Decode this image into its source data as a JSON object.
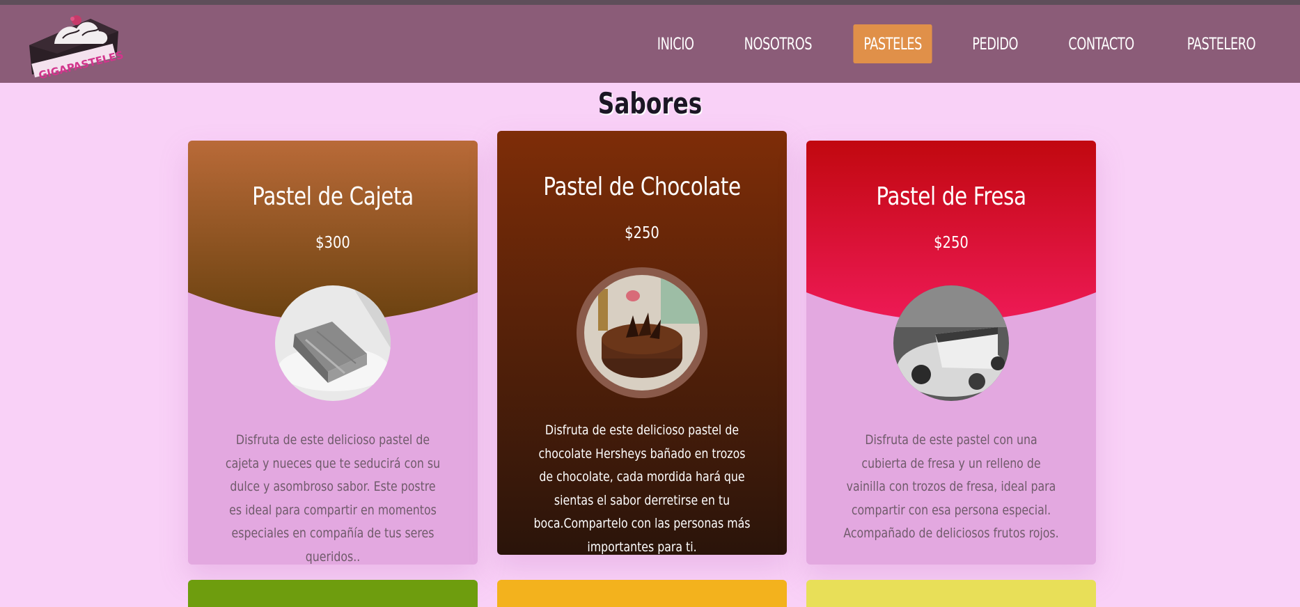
{
  "header": {
    "logo_text": "GIGAPASTELES",
    "nav": [
      {
        "label": "INICIO",
        "active": false
      },
      {
        "label": "NOSOTROS",
        "active": false
      },
      {
        "label": "PASTELES",
        "active": true
      },
      {
        "label": "PEDIDO",
        "active": false
      },
      {
        "label": "CONTACTO",
        "active": false
      },
      {
        "label": "PASTELERO",
        "active": false
      }
    ]
  },
  "section": {
    "title": "Sabores"
  },
  "cards": [
    {
      "title": "Pastel de Cajeta",
      "price": "$300",
      "image": "cajeta-cake-photo",
      "description": "Disfruta de este delicioso pastel de cajeta y nueces que te seducirá con su dulce y asombroso sabor. Este postre es ideal para compartir en momentos especiales en compañía de tus seres queridos.."
    },
    {
      "title": "Pastel de Chocolate",
      "price": "$250",
      "image": "chocolate-cake-photo",
      "description": "Disfruta de este delicioso pastel de chocolate Hersheys bañado en trozos de chocolate, cada mordida hará que sientas el sabor derretirse en tu boca.Compartelo con las personas más importantes para ti."
    },
    {
      "title": "Pastel de Fresa",
      "price": "$250",
      "image": "fresa-cake-photo",
      "description": "Disfruta de este pastel con una cubierta de fresa y un relleno de vainilla con trozos de fresa, ideal para compartir con esa persona especial. Acompañado de deliciosos frutos rojos."
    }
  ],
  "colors": {
    "header_bg": "#8b5c78",
    "page_bg": "#f9d1f7",
    "nav_active": "#e09049",
    "card_body": "#e3a8e0",
    "cajeta_top": "#b96a38",
    "cajeta_bottom": "#6b4210",
    "chocolate_top": "#7e2d08",
    "chocolate_bottom": "#2a140a",
    "fresa_top": "#c1080f",
    "fresa_bottom": "#ee1a56",
    "next_row": [
      "#6e9d0e",
      "#f3b21d",
      "#e8df58"
    ]
  }
}
